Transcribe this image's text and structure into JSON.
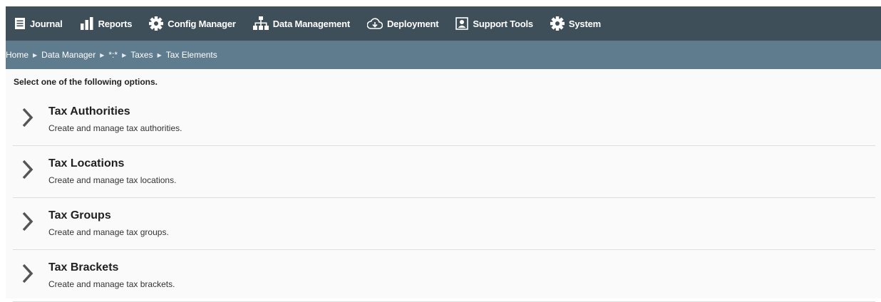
{
  "nav": {
    "items": [
      {
        "label": "Journal",
        "icon": "journal-icon"
      },
      {
        "label": "Reports",
        "icon": "bar-chart-icon"
      },
      {
        "label": "Config Manager",
        "icon": "gear-icon"
      },
      {
        "label": "Data Management",
        "icon": "hierarchy-icon"
      },
      {
        "label": "Deployment",
        "icon": "cloud-download-icon"
      },
      {
        "label": "Support Tools",
        "icon": "support-user-icon"
      },
      {
        "label": "System",
        "icon": "gear-icon"
      }
    ]
  },
  "breadcrumb": {
    "items": [
      "Home",
      "Data Manager",
      "*:*",
      "Taxes",
      "Tax Elements"
    ],
    "separator": "▶"
  },
  "content": {
    "intro": "Select one of the following options.",
    "options": [
      {
        "title": "Tax Authorities",
        "description": "Create and manage tax authorities."
      },
      {
        "title": "Tax Locations",
        "description": "Create and manage tax locations."
      },
      {
        "title": "Tax Groups",
        "description": "Create and manage tax groups."
      },
      {
        "title": "Tax Brackets",
        "description": "Create and manage tax brackets."
      }
    ]
  },
  "colors": {
    "topbar": "#3f4f59",
    "breadcrumb_bar": "#5f7b8e",
    "content_bg": "#fafafa",
    "chevron": "#555555"
  }
}
